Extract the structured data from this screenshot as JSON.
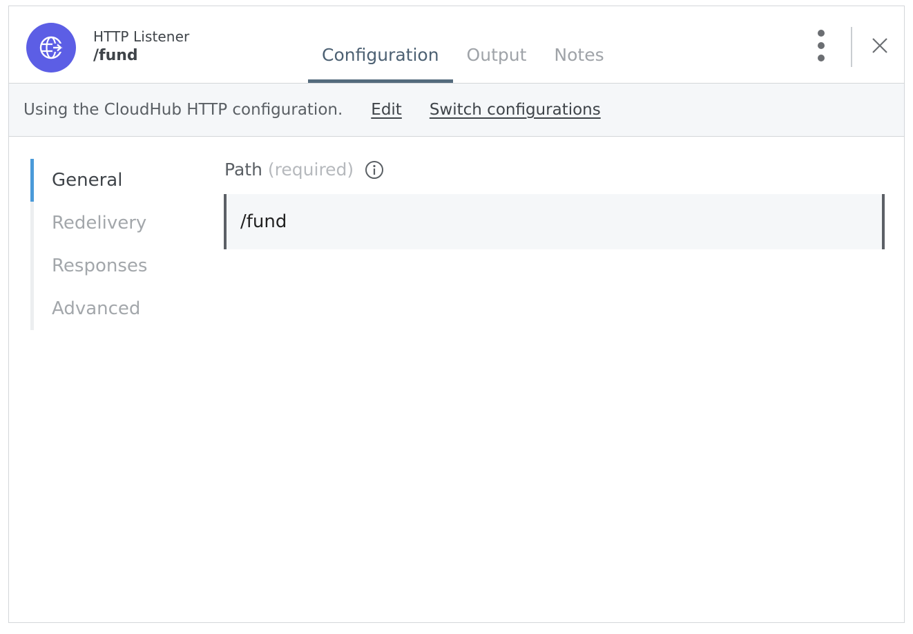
{
  "header": {
    "subtitle": "HTTP Listener",
    "title": "/fund",
    "icon": "globe-arrow-icon",
    "accent_color": "#5c5ee5"
  },
  "tabs": [
    {
      "label": "Configuration",
      "active": true
    },
    {
      "label": "Output",
      "active": false
    },
    {
      "label": "Notes",
      "active": false
    }
  ],
  "config_bar": {
    "text": "Using the CloudHub HTTP configuration.",
    "edit_label": "Edit",
    "switch_label": "Switch configurations"
  },
  "sidenav": {
    "items": [
      {
        "label": "General",
        "active": true
      },
      {
        "label": "Redelivery",
        "active": false
      },
      {
        "label": "Responses",
        "active": false
      },
      {
        "label": "Advanced",
        "active": false
      }
    ],
    "active_color": "#4a9ad9"
  },
  "field": {
    "label": "Path",
    "required_text": "(required)",
    "value": "/fund"
  }
}
